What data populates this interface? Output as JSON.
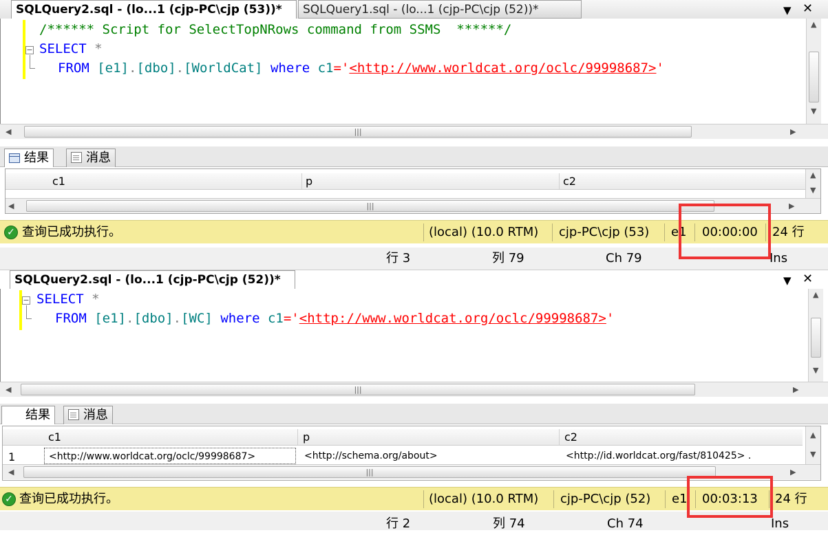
{
  "top": {
    "tabs": [
      {
        "label": "SQLQuery2.sql - (lo...1 (cjp-PC\\cjp (53))*"
      },
      {
        "label": "SQLQuery1.sql - (lo...1 (cjp-PC\\cjp (52))*"
      }
    ],
    "dropdown": "▼",
    "close": "✕",
    "code": {
      "comment": "/****** Script for SelectTopNRows command from SSMS  ******/",
      "select_kw": "SELECT",
      "star": "*",
      "from_kw": "FROM",
      "db": "[e1]",
      "dot1": ".",
      "schema": "[dbo]",
      "dot2": ".",
      "table": "[WorldCat]",
      "where_kw": "where",
      "col": "c1",
      "eq_quote": "='",
      "url": "<http://www.worldcat.org/oclc/99998687>",
      "end_quote": "'"
    },
    "results": {
      "tab_results": "结果",
      "tab_messages": "消息",
      "columns": [
        "c1",
        "p",
        "c2"
      ]
    },
    "status": {
      "message": "查询已成功执行。",
      "server": "(local) (10.0 RTM)",
      "user": "cjp-PC\\cjp (53)",
      "db": "e1",
      "time": "00:00:00",
      "rows": "24 行"
    },
    "position": {
      "line": "行 3",
      "col": "列 79",
      "ch": "Ch 79",
      "mode": "Ins"
    }
  },
  "bottom": {
    "tabs": [
      {
        "label": "SQLQuery2.sql - (lo...1 (cjp-PC\\cjp (52))*"
      }
    ],
    "dropdown": "▼",
    "close": "✕",
    "code": {
      "select_kw": "SELECT",
      "star": "*",
      "from_kw": "FROM",
      "db": "[e1]",
      "dot1": ".",
      "schema": "[dbo]",
      "dot2": ".",
      "table": "[WC]",
      "where_kw": "where",
      "col": "c1",
      "eq_quote": "='",
      "url": "<http://www.worldcat.org/oclc/99998687>",
      "end_quote": "'"
    },
    "results": {
      "tab_results": "结果",
      "tab_messages": "消息",
      "columns": [
        "c1",
        "p",
        "c2"
      ],
      "rows": [
        {
          "num": "1",
          "c1": "<http://www.worldcat.org/oclc/99998687>",
          "p": "<http://schema.org/about>",
          "c2": "<http://id.worldcat.org/fast/810425> ."
        }
      ]
    },
    "status": {
      "message": "查询已成功执行。",
      "server": "(local) (10.0 RTM)",
      "user": "cjp-PC\\cjp (52)",
      "db": "e1",
      "time": "00:03:13",
      "rows": "24 行"
    },
    "position": {
      "line": "行 2",
      "col": "列 74",
      "ch": "Ch 74",
      "mode": "Ins"
    }
  },
  "colors": {
    "highlight": "#ee3333",
    "status_bg": "#f5ec9b",
    "keyword": "#0000ff",
    "comment": "#008000",
    "string": "#ff0000"
  }
}
